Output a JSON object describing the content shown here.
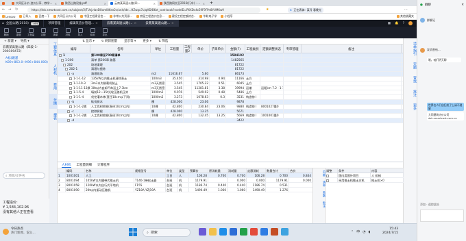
{
  "browser": {
    "tabs": [
      {
        "label": "",
        "active": false
      },
      {
        "label": "大同区计价-造价分享、教学...",
        "active": false
      },
      {
        "label": "陕西山路设施.pdf",
        "active": false
      },
      {
        "label": "云南某高速公路(四...",
        "active": true
      },
      {
        "label": "陕西路网交至2016(行车) - Powe...",
        "active": false
      }
    ],
    "url": "https://dsk.smartcost.com.cn/subject/2/TUnjvlaeDUoml86ee2c/unit/ide...HZwqu7u/qHD/B6st_cost-book?nodeID=P6XDv4cE9F9FPn8YUM6w9",
    "bookmarks": [
      "Lenovo",
      "已导入",
      "百度一下",
      "大同区计价公司",
      "中国工程建设信...",
      "非常公共资源...",
      "房屋工程造价信息...",
      "建设工程定额综合..",
      "华联电子学",
      "小程序"
    ],
    "right_bookmark": "其他收藏夹",
    "download_label": "正在表体:",
    "chat_preview": "某号 春晚光"
  },
  "app": {
    "project_label": "全国公路(2018)",
    "project_badge": "升级版",
    "tabs": [
      "项目管理",
      "编辑某造价管理...",
      "云南某高速公路(...",
      "云南某高速公路..."
    ],
    "tools": [
      "撤销",
      "重做",
      "工程量",
      "定额",
      "清单",
      "材料",
      "导入",
      "费用",
      "导出"
    ],
    "right_tools": [
      "⛶",
      "☀",
      "✉"
    ]
  },
  "left_panel": {
    "toolbar": [
      "新建",
      "导航"
    ],
    "root": "云南某高速公路（四段-1-200109472）",
    "selected": "A标(路基 K89+863.0~K96+844.000)",
    "vtabs": [
      "工程信息",
      "人材机",
      "费用",
      "分摊",
      "报表"
    ],
    "search_placeholder": "项目/文件名",
    "bottom_label": "工程造价:",
    "bottom_value": "¥ 1,584,102.96",
    "bottom_note": "没有其他人正在查看"
  },
  "grid": {
    "toolbar": [
      "⇅ 显示 ▾",
      "↻ 刷新图量",
      "显示等 ▾",
      "更多 ▾",
      "⇅ 筛选"
    ],
    "headers": [
      "编号",
      "名称",
      "单位",
      "工程量",
      "工程量2",
      "单价",
      "子目单价",
      "金额(F)",
      "工程类别",
      "定额调整状态",
      "专审管理",
      "备注"
    ],
    "rows": [
      {
        "code": "1",
        "name": "第100章至700章清单",
        "unit": "",
        "qty": "",
        "qty2": "",
        "price": "",
        "sub": "",
        "amount": "1584102",
        "cat": "",
        "adj": "",
        "note": "",
        "cls": "blue bold",
        "ind": 0
      },
      {
        "code": "1-200",
        "name": "清单 第200章 路基",
        "unit": "",
        "qty": "",
        "qty2": "",
        "price": "",
        "sub": "",
        "amount": "1482565",
        "cat": "",
        "adj": "",
        "note": "",
        "cls": "blue",
        "ind": 1
      },
      {
        "code": "202",
        "name": "场地清理",
        "unit": "",
        "qty": "",
        "qty2": "",
        "price": "",
        "sub": "",
        "amount": "81722",
        "cat": "",
        "adj": "",
        "note": "",
        "cls": "blue",
        "ind": 2
      },
      {
        "code": "202-1",
        "name": "清理与掘除",
        "unit": "",
        "qty": "",
        "qty2": "",
        "price": "",
        "sub": "",
        "amount": "81722",
        "cat": "",
        "adj": "",
        "note": "",
        "cls": "blue",
        "ind": 3
      },
      {
        "code": "-a",
        "name": "清理现场",
        "unit": "m2",
        "qty": "11616.67",
        "qty2": "",
        "price": "5.60",
        "sub": "",
        "amount": "86173",
        "cat": "",
        "adj": "",
        "note": "",
        "cls": "blue",
        "ind": 4
      },
      {
        "code": "1-1-1-12",
        "name": "135kW以内推土机清除表土",
        "unit": "100m3",
        "qty": "35.450",
        "qty2": "",
        "price": "314.98",
        "sub": "0.94",
        "amount": "11166",
        "cat": "土方",
        "adj": "",
        "note": "",
        "cls": "",
        "ind": 5
      },
      {
        "code": "1-1-10-3",
        "name": "3m3以内装载机装土",
        "unit": "m3天然密",
        "qty": "3.545",
        "qty2": "",
        "price": "1705.22",
        "sub": "0.51",
        "amount": "6045",
        "cat": "土方",
        "adj": "",
        "note": "",
        "cls": "",
        "ind": 5
      },
      {
        "code": "1-1-11-13换",
        "name": "30t以内自卸汽车运土7.3km",
        "unit": "m3天然密",
        "qty": "3.545",
        "qty2": "",
        "price": "11281.81",
        "sub": "3.38",
        "amount": "39994",
        "cat": "运输",
        "adj": "运距km 7.2 · 1-1-11-14×12",
        "note": "",
        "cls": "",
        "ind": 5
      },
      {
        "code": "1-1-5-4",
        "name": "填前12～15t光轮压路机压实",
        "unit": "1000m2",
        "qty": "9.976",
        "qty2": "",
        "price": "549.92",
        "sub": "0.48",
        "amount": "5486",
        "cat": "土方",
        "adj": "",
        "note": "",
        "cls": "",
        "ind": 5
      },
      {
        "code": "1-1-1-4",
        "name": "伐挖灌木林(直径10cm以下)砍",
        "unit": "1000m2",
        "qty": "3.273",
        "qty2": "",
        "price": "1078.63",
        "sub": "0.3",
        "amount": "3531",
        "cat": "构造物 I",
        "adj": "",
        "note": "",
        "cls": "",
        "ind": 5
      },
      {
        "code": "-b",
        "name": "砍伐树木",
        "unit": "棵",
        "qty": "428.000",
        "qty2": "",
        "price": "23.06",
        "sub": "",
        "amount": "9878",
        "cat": "",
        "adj": "",
        "note": "",
        "cls": "blue",
        "ind": 4
      },
      {
        "code": "1-1-1-2换",
        "name": "人工伐树挖根(直径10cm以内)",
        "unit": "10棵",
        "qty": "42.800",
        "qty2": "",
        "price": "230.84",
        "sub": "23.06",
        "amount": "9880",
        "cat": "构造物 I",
        "adj": "8001027量0",
        "note": "",
        "cls": "",
        "ind": 5
      },
      {
        "code": "-c",
        "name": "挖除树根",
        "unit": "棵",
        "qty": "428.000",
        "qty2": "",
        "price": "13.25",
        "sub": "",
        "amount": "5671",
        "cat": "",
        "adj": "",
        "note": "",
        "cls": "blue",
        "ind": 4
      },
      {
        "code": "1-1-1-2换",
        "name": "人工伐树挖根(直径10cm以内)",
        "unit": "10棵",
        "qty": "42.800",
        "qty2": "",
        "price": "132.45",
        "sub": "13.25",
        "amount": "5669",
        "cat": "构造物 I",
        "adj": "1001001量0",
        "note": "",
        "cls": "",
        "ind": 5
      },
      {
        "code": "-d",
        "name": "",
        "unit": "",
        "qty": "",
        "qty2": "",
        "price": "",
        "sub": "",
        "amount": "3422",
        "cat": "",
        "adj": "",
        "note": "",
        "cls": "blue",
        "ind": 4
      }
    ]
  },
  "right_vtabs": [
    "清单指引",
    "定额",
    "查找",
    "批注",
    "更多"
  ],
  "bottom": {
    "tabs": [
      "人材机",
      "工程量明细",
      "计算程序"
    ],
    "headers": [
      "",
      "编码",
      "名称",
      "规格型号",
      "单位",
      "类型",
      "预算价",
      "原消耗量",
      "消耗量",
      "定额消耗",
      "数量合计",
      "合价"
    ],
    "rows": [
      [
        "1",
        "1001001",
        "人工",
        "",
        "工日",
        "人",
        "106.28",
        "0.700",
        "0.700",
        "106.28",
        "0.700",
        "0.844"
      ],
      [
        "2",
        "8001094",
        "105kW以内履带式推土机",
        "T140-1带松土器",
        "台班",
        "机",
        "1179.91",
        "",
        "0.000",
        "0.000",
        "1179.91",
        "0.000"
      ],
      [
        "3",
        "8001058",
        "120kW以内自行式平地机",
        "F155",
        "台班",
        "机",
        "1186.74",
        "0.440",
        "0.440",
        "1186.74",
        "0.531"
      ],
      [
        "4",
        "8001090",
        "20t以内振动压路机",
        "YZ18A,YZJ19A",
        "台班",
        "机",
        "1490.49",
        "1.060",
        "1.060",
        "1490.49",
        "1.276"
      ]
    ],
    "side_vtabs": [
      "内容",
      "清单",
      "系数",
      "批注"
    ],
    "side_headers": [
      "调整",
      "条件",
      "内容"
    ],
    "side_rows": [
      [
        "国内用国外项目",
        "人 机械"
      ],
      [
        "采用推土机推土方机",
        "推土机×0"
      ]
    ]
  },
  "taskbar": {
    "weather": "今日热点",
    "weather_sub": "热门新闻、说么...",
    "search_placeholder": "搜索",
    "time": "15:43",
    "date": "2024/7/15",
    "ime": "中"
  },
  "wechat": {
    "header": "群聊",
    "messages": [
      {
        "text": "群聊记",
        "y": 30
      },
      {
        "text": "发消息给...",
        "y": 70
      },
      {
        "text": "哦，咱们明天聊",
        "y": 85
      }
    ],
    "bubble_1": "世界在人们自扫发了上请不理解",
    "bubble_2": "大同建筑计价公司 dsk.smartcost.com.cn",
    "footer": "添加 · 遥控此处"
  },
  "colors": {
    "accent": "#1a6ee2",
    "header_bg": "#1b1f2a",
    "row_highlight": "#e3edfb"
  }
}
